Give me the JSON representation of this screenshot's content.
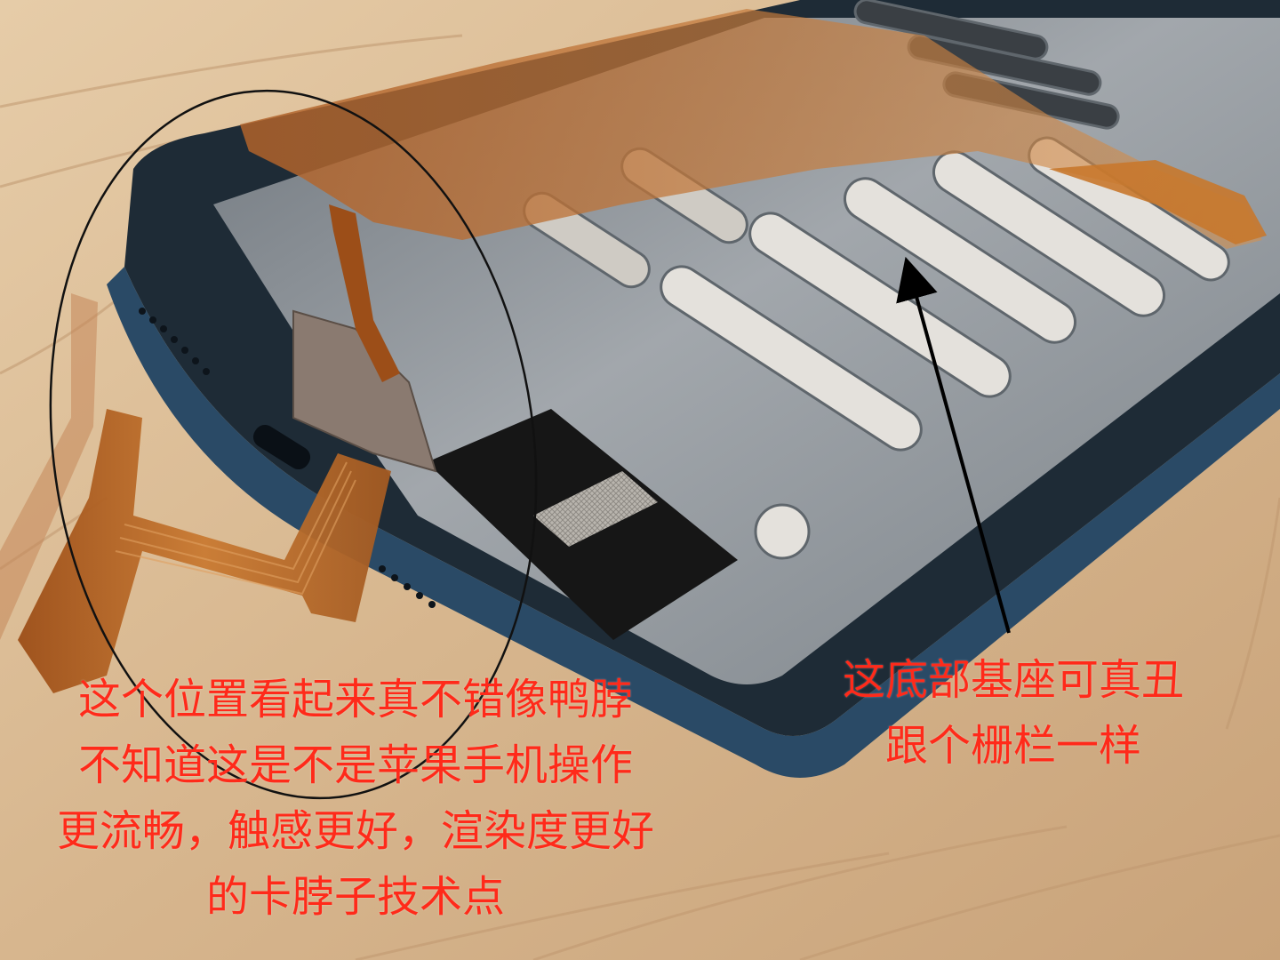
{
  "image": {
    "kind": "photo",
    "subject": "disassembled smartphone with orange flex cables over a grille-like metal base plate"
  },
  "annotations": {
    "left_caption": [
      "这个位置看起来真不错像鸭脖",
      "不知道这是不是苹果手机操作",
      "更流畅，触感更好，渲染度更好",
      "的卡脖子技术点"
    ],
    "right_caption": [
      "这底部基座可真丑",
      "跟个栅栏一样"
    ]
  },
  "colors": {
    "caption": "#ff2a1a",
    "circle": "#111111",
    "arrow": "#000000",
    "wood": "#d8b894",
    "flex_cable": "#c8782c",
    "metal_plate": "#8e949a",
    "phone_frame": "#1e2b36"
  }
}
